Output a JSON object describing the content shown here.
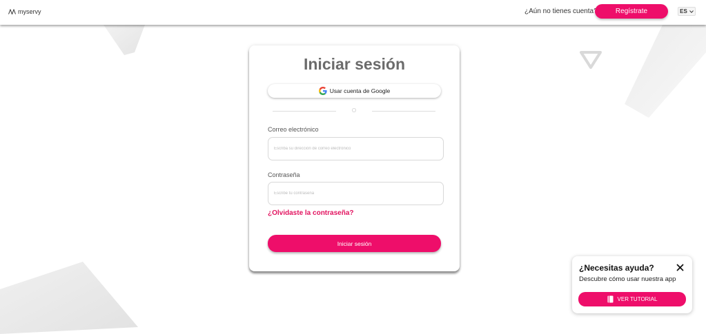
{
  "header": {
    "logo_text": "myservy",
    "signup_question": "¿Aún no tienes cuenta?",
    "signup_button": "Regístrate",
    "language": "ES"
  },
  "login": {
    "title": "Iniciar sesión",
    "google_button": "Usar cuenta de Google",
    "divider_text": "O",
    "email_label": "Correo electrónico",
    "email_placeholder": "Escriba su dirección de correo electrónico",
    "password_label": "Contraseña",
    "password_placeholder": "Escribe tu contraseña",
    "forgot_link": "¿Olvidaste la contraseña?",
    "submit_button": "Iniciar sesión"
  },
  "help": {
    "title": "¿Necesitas ayuda?",
    "subtitle": "Descubre cómo usar nuestra app",
    "button": "VER TUTORIAL"
  },
  "colors": {
    "accent": "#ee0e6a",
    "link": "#e2135f",
    "title_gray": "#6b6b6b"
  },
  "icons": [
    "logo-icon",
    "chevron-down-icon",
    "google-icon",
    "close-icon",
    "book-icon"
  ]
}
